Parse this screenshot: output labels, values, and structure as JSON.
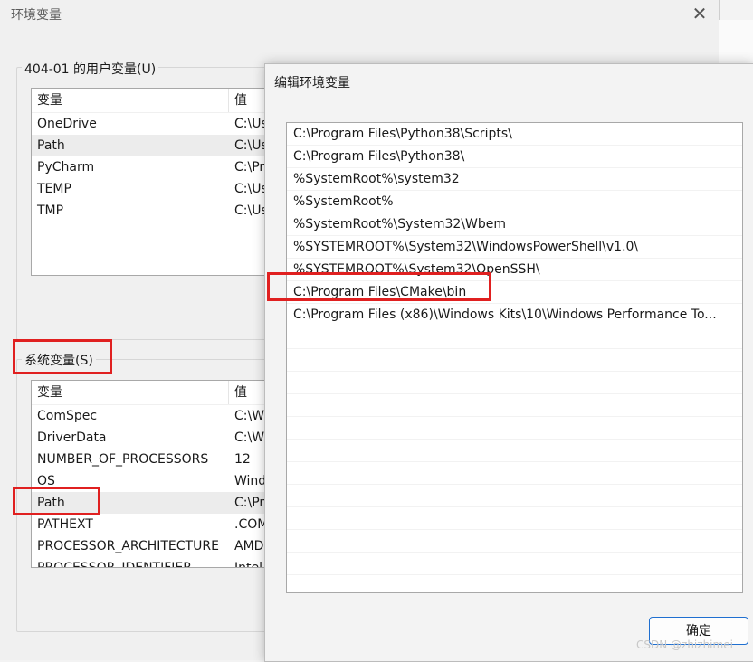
{
  "env_window": {
    "title": "环境变量",
    "user_group_label": "404-01 的用户变量(U)",
    "user_vars": {
      "headers": [
        "变量",
        "值"
      ],
      "rows": [
        {
          "name": "OneDrive",
          "value": "C:\\Us"
        },
        {
          "name": "Path",
          "value": "C:\\Us"
        },
        {
          "name": "PyCharm",
          "value": "C:\\Pr"
        },
        {
          "name": "TEMP",
          "value": "C:\\Us"
        },
        {
          "name": "TMP",
          "value": "C:\\Us"
        }
      ]
    },
    "system_group_label": "系统变量(S)",
    "system_vars": {
      "headers": [
        "变量",
        "值"
      ],
      "rows": [
        {
          "name": "ComSpec",
          "value": "C:\\W"
        },
        {
          "name": "DriverData",
          "value": "C:\\W"
        },
        {
          "name": "NUMBER_OF_PROCESSORS",
          "value": "12"
        },
        {
          "name": "OS",
          "value": "Wind"
        },
        {
          "name": "Path",
          "value": "C:\\Pr"
        },
        {
          "name": "PATHEXT",
          "value": ".COM"
        },
        {
          "name": "PROCESSOR_ARCHITECTURE",
          "value": "AMD"
        },
        {
          "name": "PROCESSOR_IDENTIFIER",
          "value": "Intel"
        }
      ]
    }
  },
  "edit_dialog": {
    "title": "编辑环境变量",
    "paths": [
      "C:\\Program Files\\Python38\\Scripts\\",
      "C:\\Program Files\\Python38\\",
      "%SystemRoot%\\system32",
      "%SystemRoot%",
      "%SystemRoot%\\System32\\Wbem",
      "%SYSTEMROOT%\\System32\\WindowsPowerShell\\v1.0\\",
      "%SYSTEMROOT%\\System32\\OpenSSH\\",
      "C:\\Program Files\\CMake\\bin",
      "C:\\Program Files (x86)\\Windows Kits\\10\\Windows Performance To..."
    ],
    "ok_label": "确定"
  },
  "watermark": "CSDN @zhizhimei",
  "colors": {
    "highlight_red": "#e02020",
    "button_border": "#1f6fd0"
  }
}
